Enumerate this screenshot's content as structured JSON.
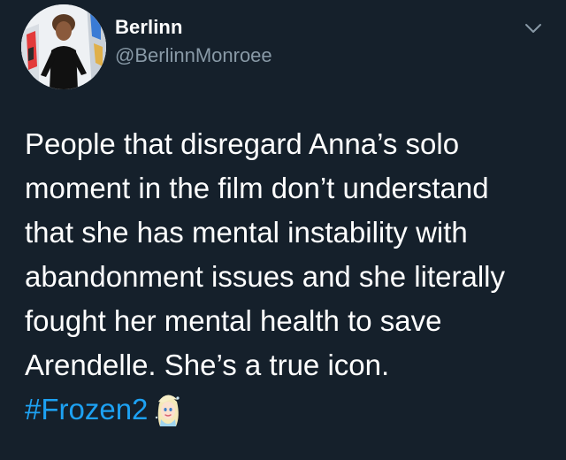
{
  "author": {
    "display_name": "Berlinn",
    "handle": "@BerlinnMonroee",
    "avatar_icon": "profile-photo"
  },
  "menu": {
    "icon": "chevron-down-icon",
    "color": "#8899a6"
  },
  "tweet": {
    "lines": [
      "People that disregard Anna’s solo",
      "moment in the film don’t understand",
      "that she has mental instability with",
      "abandonment issues and she literally",
      "fought her mental health to save",
      "Arendelle. She’s a true icon."
    ],
    "hashtag": "#Frozen2",
    "emoji": "elsa-emoji"
  },
  "colors": {
    "background": "#15202b",
    "text": "#ffffff",
    "secondary_text": "#8899a6",
    "link": "#1da1f2"
  }
}
